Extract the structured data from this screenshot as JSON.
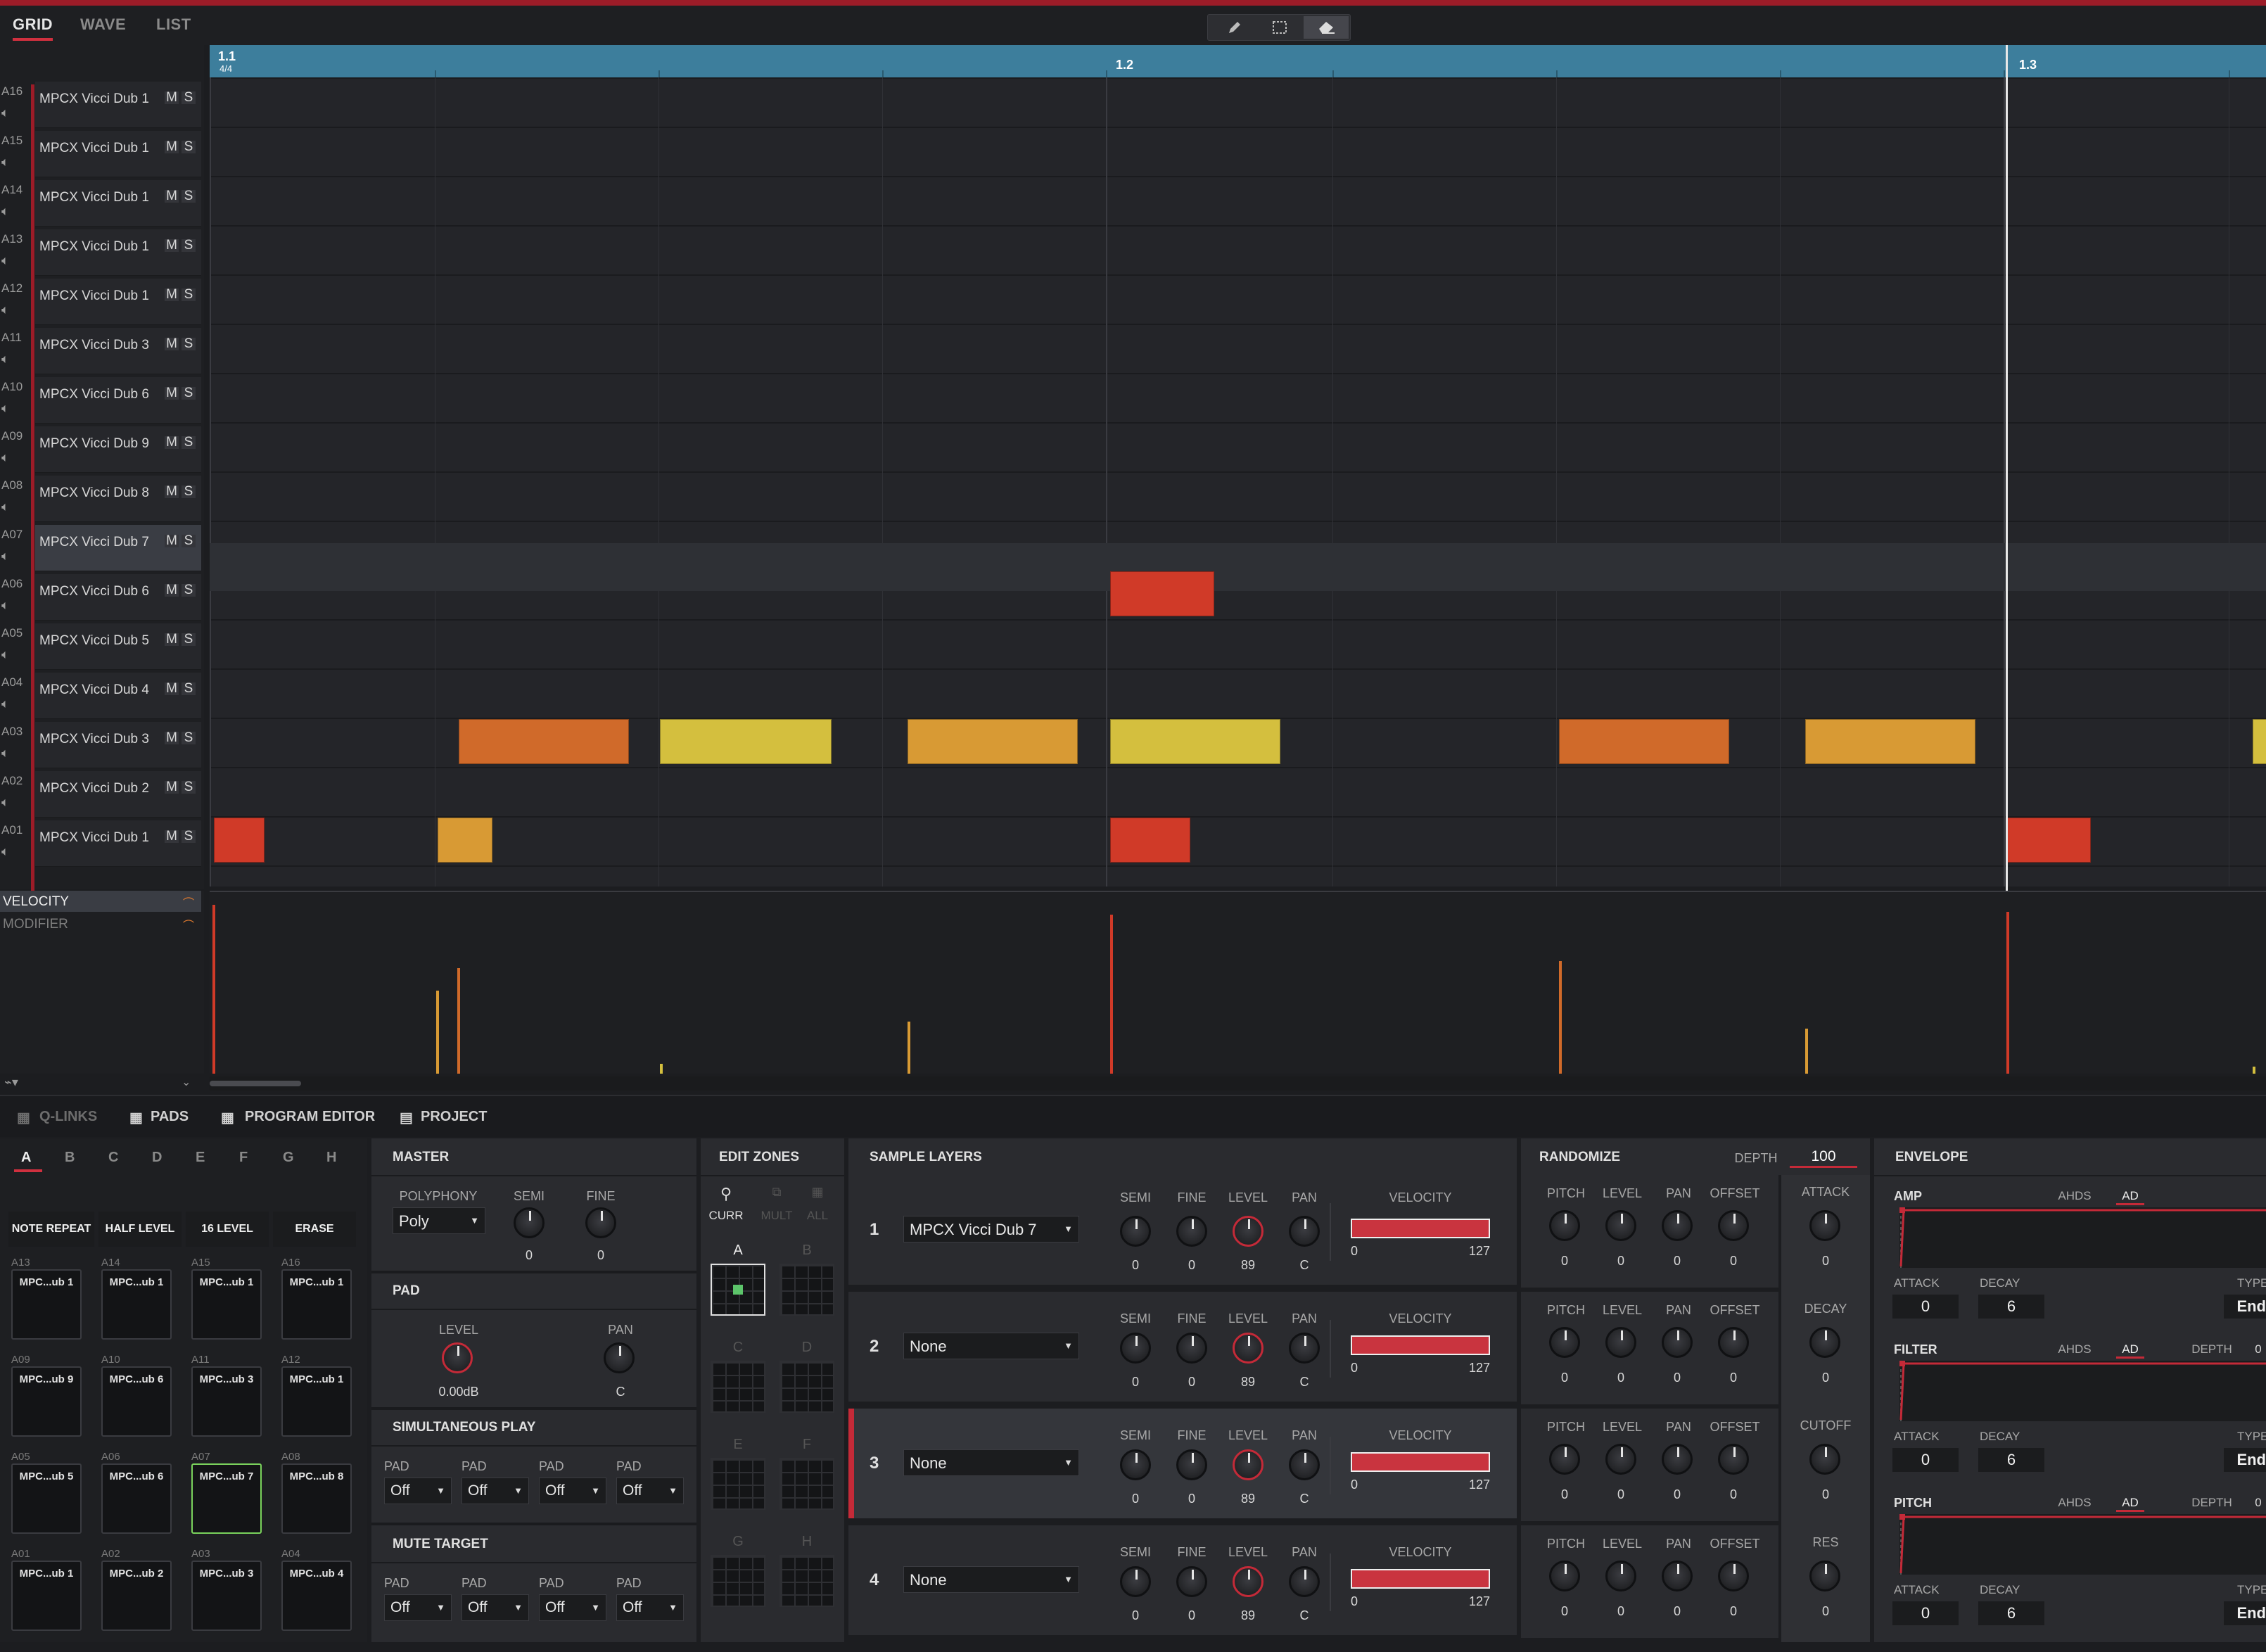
{
  "view_tabs": {
    "grid": "GRID",
    "wave": "WAVE",
    "list": "LIST"
  },
  "toolbar": {
    "pencil_icon": "pencil-icon",
    "select_icon": "marquee-select-icon",
    "erase_icon": "eraser-icon"
  },
  "ruler": {
    "bar1": "1.1",
    "timesig": "4/4",
    "bar2": "1.2",
    "bar3": "1.3"
  },
  "tracks": [
    {
      "pad": "A16",
      "name": "MPCX Vicci Dub 1"
    },
    {
      "pad": "A15",
      "name": "MPCX Vicci Dub 1"
    },
    {
      "pad": "A14",
      "name": "MPCX Vicci Dub 1"
    },
    {
      "pad": "A13",
      "name": "MPCX Vicci Dub 1"
    },
    {
      "pad": "A12",
      "name": "MPCX Vicci Dub 1"
    },
    {
      "pad": "A11",
      "name": "MPCX Vicci Dub 3"
    },
    {
      "pad": "A10",
      "name": "MPCX Vicci Dub 6"
    },
    {
      "pad": "A09",
      "name": "MPCX Vicci Dub 9"
    },
    {
      "pad": "A08",
      "name": "MPCX Vicci Dub 8"
    },
    {
      "pad": "A07",
      "name": "MPCX Vicci Dub 7"
    },
    {
      "pad": "A06",
      "name": "MPCX Vicci Dub 6"
    },
    {
      "pad": "A05",
      "name": "MPCX Vicci Dub 5"
    },
    {
      "pad": "A04",
      "name": "MPCX Vicci Dub 4"
    },
    {
      "pad": "A03",
      "name": "MPCX Vicci Dub 3"
    },
    {
      "pad": "A02",
      "name": "MPCX Vicci Dub 2"
    },
    {
      "pad": "A01",
      "name": "MPCX Vicci Dub 1"
    }
  ],
  "track_buttons": {
    "mute": "M",
    "solo": "S"
  },
  "note_colors": {
    "red": "#d03a28",
    "orange": "#d06a2a",
    "amber": "#d89a34",
    "yellow": "#d4bf3e"
  },
  "lanes": {
    "velocity": "VELOCITY",
    "modifier": "MODIFIER"
  },
  "bottom_tabs": {
    "qlinks": "Q-LINKS",
    "pads": "PADS",
    "program_editor": "PROGRAM EDITOR",
    "project": "PROJECT"
  },
  "bank_letters": [
    "A",
    "B",
    "C",
    "D",
    "E",
    "F",
    "G",
    "H"
  ],
  "pad_buttons": {
    "note_repeat": "NOTE REPEAT",
    "half_level": "HALF LEVEL",
    "level16": "16 LEVEL",
    "erase": "ERASE"
  },
  "pads": [
    {
      "id": "A13",
      "label": "MPC...ub 1"
    },
    {
      "id": "A14",
      "label": "MPC...ub 1"
    },
    {
      "id": "A15",
      "label": "MPC...ub 1"
    },
    {
      "id": "A16",
      "label": "MPC...ub 1"
    },
    {
      "id": "A09",
      "label": "MPC...ub 9"
    },
    {
      "id": "A10",
      "label": "MPC...ub 6"
    },
    {
      "id": "A11",
      "label": "MPC...ub 3"
    },
    {
      "id": "A12",
      "label": "MPC...ub 1"
    },
    {
      "id": "A05",
      "label": "MPC...ub 5"
    },
    {
      "id": "A06",
      "label": "MPC...ub 6"
    },
    {
      "id": "A07",
      "label": "MPC...ub 7"
    },
    {
      "id": "A08",
      "label": "MPC...ub 8"
    },
    {
      "id": "A01",
      "label": "MPC...ub 1"
    },
    {
      "id": "A02",
      "label": "MPC...ub 2"
    },
    {
      "id": "A03",
      "label": "MPC...ub 3"
    },
    {
      "id": "A04",
      "label": "MPC...ub 4"
    }
  ],
  "master": {
    "title": "MASTER",
    "polyphony_label": "POLYPHONY",
    "polyphony": "Poly",
    "semi_label": "SEMI",
    "semi": "0",
    "fine_label": "FINE",
    "fine": "0"
  },
  "pad_section": {
    "title": "PAD",
    "level_label": "LEVEL",
    "level": "0.00dB",
    "pan_label": "PAN",
    "pan": "C"
  },
  "sim_play": {
    "title": "SIMULTANEOUS PLAY",
    "pad_label": "PAD",
    "values": [
      "Off",
      "Off",
      "Off",
      "Off"
    ]
  },
  "mute_target": {
    "title": "MUTE TARGET",
    "pad_label": "PAD",
    "values": [
      "Off",
      "Off",
      "Off",
      "Off"
    ]
  },
  "edit_zones": {
    "title": "EDIT ZONES",
    "curr": "CURR",
    "mult": "MULT",
    "all": "ALL",
    "zones": [
      "A",
      "B",
      "C",
      "D",
      "E",
      "F",
      "G",
      "H"
    ]
  },
  "sample_layers": {
    "title": "SAMPLE LAYERS",
    "col_labels": {
      "semi": "SEMI",
      "fine": "FINE",
      "level": "LEVEL",
      "pan": "PAN",
      "velocity": "VELOCITY"
    },
    "layers": [
      {
        "num": "1",
        "sample": "MPCX Vicci Dub 7",
        "semi": "0",
        "fine": "0",
        "level": "89",
        "pan": "C",
        "vel_min": "0",
        "vel_max": "127"
      },
      {
        "num": "2",
        "sample": "None",
        "semi": "0",
        "fine": "0",
        "level": "89",
        "pan": "C",
        "vel_min": "0",
        "vel_max": "127"
      },
      {
        "num": "3",
        "sample": "None",
        "semi": "0",
        "fine": "0",
        "level": "89",
        "pan": "C",
        "vel_min": "0",
        "vel_max": "127"
      },
      {
        "num": "4",
        "sample": "None",
        "semi": "0",
        "fine": "0",
        "level": "89",
        "pan": "C",
        "vel_min": "0",
        "vel_max": "127"
      }
    ]
  },
  "randomize": {
    "title": "RANDOMIZE",
    "depth_label": "DEPTH",
    "depth": "100",
    "cols": {
      "pitch": "PITCH",
      "level": "LEVEL",
      "pan": "PAN",
      "offset": "OFFSET"
    },
    "rows": [
      [
        "0",
        "0",
        "0",
        "0"
      ],
      [
        "0",
        "0",
        "0",
        "0"
      ],
      [
        "0",
        "0",
        "0",
        "0"
      ],
      [
        "0",
        "0",
        "0",
        "0"
      ]
    ],
    "side": [
      {
        "label": "ATTACK",
        "val": "0"
      },
      {
        "label": "DECAY",
        "val": "0"
      },
      {
        "label": "CUTOFF",
        "val": "0"
      },
      {
        "label": "RES",
        "val": "0"
      }
    ]
  },
  "envelope": {
    "title": "ENVELOPE",
    "sections": [
      {
        "name": "AMP",
        "ahds": "AHDS",
        "ad": "AD",
        "depth_label": "",
        "depth": "",
        "attack_label": "ATTACK",
        "attack": "0",
        "decay_label": "DECAY",
        "decay": "6",
        "type_label": "TYPE",
        "type": "End"
      },
      {
        "name": "FILTER",
        "ahds": "AHDS",
        "ad": "AD",
        "depth_label": "DEPTH",
        "depth": "0",
        "attack_label": "ATTACK",
        "attack": "0",
        "decay_label": "DECAY",
        "decay": "6",
        "type_label": "TYPE",
        "type": "End"
      },
      {
        "name": "PITCH",
        "ahds": "AHDS",
        "ad": "AD",
        "depth_label": "DEPTH",
        "depth": "0",
        "attack_label": "ATTACK",
        "attack": "0",
        "decay_label": "DECAY",
        "decay": "6",
        "type_label": "TYPE",
        "type": "End"
      }
    ]
  }
}
